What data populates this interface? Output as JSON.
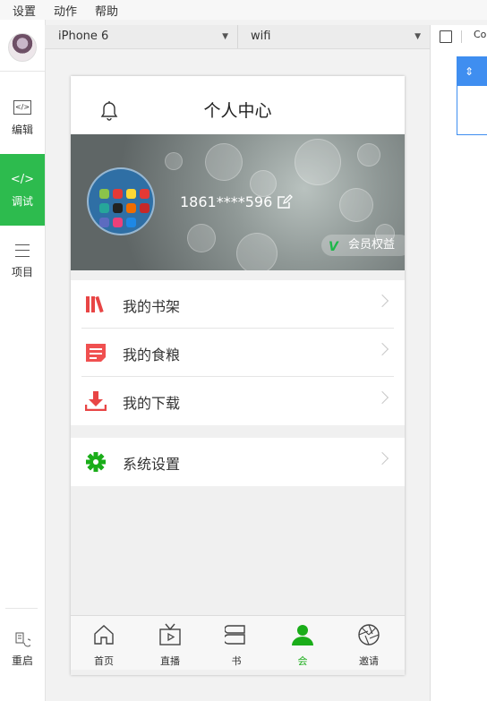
{
  "menu": [
    "设置",
    "动作",
    "帮助"
  ],
  "sidebar": {
    "items": [
      {
        "label": "编辑",
        "icon": "code-box-icon"
      },
      {
        "label": "调试",
        "icon": "code-icon",
        "active": true
      },
      {
        "label": "项目",
        "icon": "list-icon"
      }
    ],
    "bottom": {
      "label": "重启",
      "icon": "restart-icon"
    }
  },
  "toolbar": {
    "device": "iPhone 6",
    "network": "wifi"
  },
  "rightpane": {
    "tab_text": "Co"
  },
  "page": {
    "title": "个人中心",
    "phone": "1861****596",
    "vip_label": "会员权益",
    "vip_logo": "V",
    "list1": [
      {
        "label": "我的书架",
        "icon": "bookshelf-icon",
        "color": "#e84545"
      },
      {
        "label": "我的食粮",
        "icon": "note-icon",
        "color": "#f05050"
      },
      {
        "label": "我的下载",
        "icon": "download-icon",
        "color": "#e84545"
      }
    ],
    "list2": [
      {
        "label": "系统设置",
        "icon": "gear-icon",
        "color": "#1aad19"
      }
    ]
  },
  "tabbar": [
    {
      "label": "首页",
      "icon": "home-icon"
    },
    {
      "label": "直播",
      "icon": "tv-icon"
    },
    {
      "label": "书",
      "icon": "book-icon"
    },
    {
      "label": "会",
      "icon": "user-icon",
      "active": true
    },
    {
      "label": "邀请",
      "icon": "aperture-icon"
    }
  ],
  "colors": {
    "accent": "#2dbb4e",
    "tab_active": "#1aad19"
  }
}
